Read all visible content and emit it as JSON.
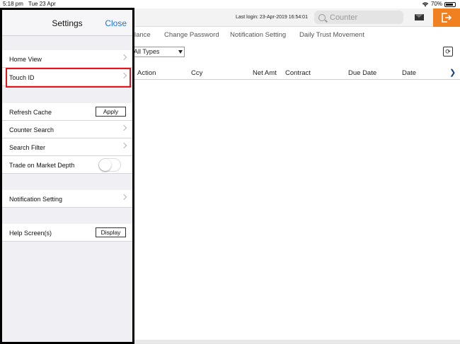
{
  "statusbar": {
    "time": "5:18 pm",
    "date": "Tue 23 Apr",
    "battery": "70%",
    "battery_level": 0.7
  },
  "header": {
    "last_login": "Last login: 23-Apr-2019 16:54:01",
    "search_placeholder": "Counter",
    "icons": {
      "search": "search-icon",
      "mail": "mail-icon",
      "logout": "logout-icon"
    },
    "logout_color": "#f08020"
  },
  "tabs": [
    "lance",
    "Change Password",
    "Notification Setting",
    "Daily Trust Movement"
  ],
  "filter": {
    "selected": "All Types"
  },
  "table": {
    "columns": [
      "Action",
      "Ccy",
      "Net Amt",
      "Contract",
      "Due Date",
      "Date"
    ],
    "next_symbol": "❯"
  },
  "settings": {
    "title": "Settings",
    "close_label": "Close",
    "rows": {
      "home_view": "Home View",
      "touch_id": "Touch ID",
      "refresh_cache": "Refresh Cache",
      "apply": "Apply",
      "counter_search": "Counter Search",
      "search_filter": "Search Filter",
      "trade_market_depth": "Trade on Market Depth",
      "trade_market_depth_on": false,
      "notification_setting": "Notification Setting",
      "help_screens": "Help Screen(s)",
      "display": "Display"
    },
    "highlight_color": "#e8141b"
  }
}
